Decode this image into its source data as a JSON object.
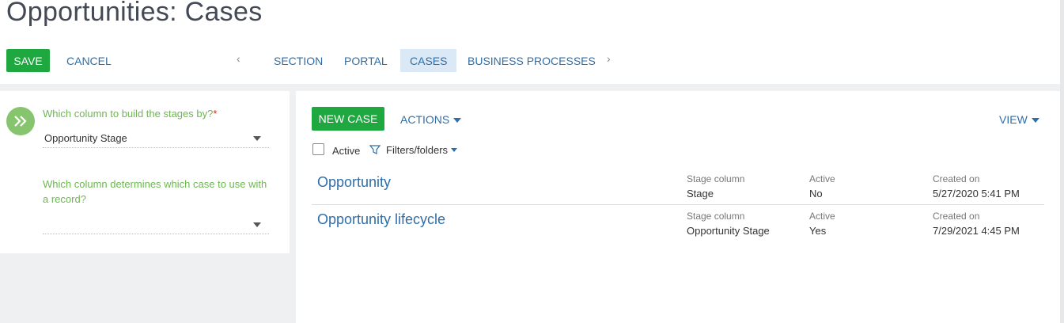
{
  "page": {
    "title": "Opportunities: Cases"
  },
  "toolbar": {
    "save_label": "SAVE",
    "cancel_label": "CANCEL"
  },
  "tabs": [
    {
      "label": "SECTION"
    },
    {
      "label": "PORTAL"
    },
    {
      "label": "CASES",
      "active": true
    },
    {
      "label": "BUSINESS PROCESSES"
    }
  ],
  "settings": {
    "stages_question": "Which column to build the stages by?",
    "required_mark": "*",
    "stages_value": "Opportunity Stage",
    "case_question": "Which column determines which case to use with a record?",
    "case_value": ""
  },
  "cases_panel": {
    "new_case_label": "NEW CASE",
    "actions_label": "ACTIONS",
    "view_label": "VIEW",
    "active_filter_label": "Active",
    "filters_label": "Filters/folders",
    "columns": {
      "stage": "Stage column",
      "active": "Active",
      "created": "Created on"
    },
    "rows": [
      {
        "title": "Opportunity",
        "stage": "Stage",
        "active": "No",
        "created": "5/27/2020 5:41 PM"
      },
      {
        "title": "Opportunity lifecycle",
        "stage": "Opportunity Stage",
        "active": "Yes",
        "created": "7/29/2021 4:45 PM"
      }
    ]
  },
  "colors": {
    "accent_green": "#1fa83f",
    "link_blue": "#2f6ea8",
    "label_green": "#6cb84f",
    "tab_active_bg": "#dbe8f5"
  },
  "icons": [
    "chevron-left-icon",
    "chevron-right-icon",
    "double-chevron-right-icon",
    "chevron-down-icon",
    "filter-icon"
  ]
}
